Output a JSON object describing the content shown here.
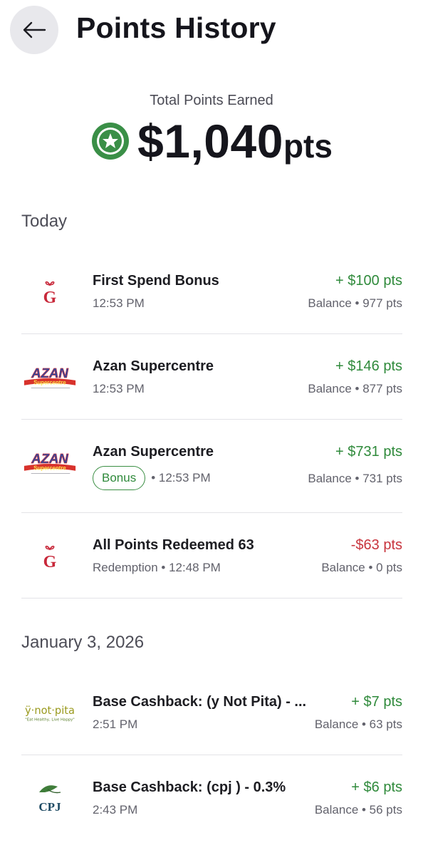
{
  "header": {
    "title": "Points History"
  },
  "summary": {
    "label": "Total Points Earned",
    "amount": "$1,040",
    "unit": "pts"
  },
  "sections": [
    {
      "title": "Today",
      "items": [
        {
          "logo": "gift-g-logo",
          "name": "First Spend Bonus",
          "sub": "12:53 PM",
          "amount": "+ $100 pts",
          "balance": "Balance • 977 pts"
        },
        {
          "logo": "azan-logo",
          "name": "Azan Supercentre",
          "sub": "12:53 PM",
          "amount": "+ $146 pts",
          "balance": "Balance • 877 pts"
        },
        {
          "logo": "azan-logo",
          "name": "Azan Supercentre",
          "badge": "Bonus",
          "sub": "• 12:53 PM",
          "amount": "+ $731 pts",
          "balance": "Balance • 731 pts"
        },
        {
          "logo": "gift-g-logo",
          "name": "All Points Redeemed 63",
          "sub": "Redemption • 12:48 PM",
          "amount": "-$63 pts",
          "balance": "Balance • 0 pts"
        }
      ]
    },
    {
      "title": "January 3, 2026",
      "items": [
        {
          "logo": "ynotpita-logo",
          "name": "Base Cashback: (y Not Pita) - ...",
          "sub": "2:51 PM",
          "amount": "+ $7 pts",
          "balance": "Balance • 63 pts"
        },
        {
          "logo": "cpj-logo",
          "name": "Base Cashback: (cpj ) - 0.3%",
          "sub": "2:43 PM",
          "amount": "+ $6 pts",
          "balance": "Balance • 56 pts"
        }
      ]
    }
  ],
  "logos": {
    "g": "G",
    "azan_top": "AZAN",
    "azan_bottom": "Supercentre",
    "ynotpita": "ӱ·not·pita",
    "ynotpita_tag": "\"Eat Healthy, Live Happy\"",
    "cpj": "CPJ"
  },
  "colors": {
    "positive": "#2f8a3b",
    "negative": "#c8343d",
    "accent": "#2f8a3b"
  }
}
